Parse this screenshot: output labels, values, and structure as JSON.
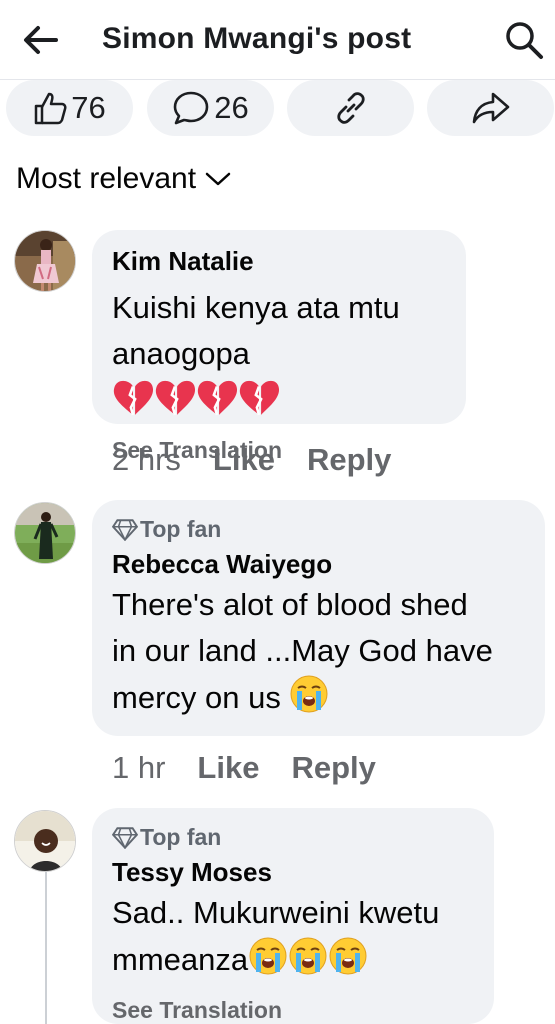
{
  "header": {
    "title": "Simon Mwangi's post",
    "back_icon": "back-arrow-icon",
    "search_icon": "search-icon"
  },
  "actions": {
    "like_count": "76",
    "comment_count": "26",
    "link_icon": "link-icon",
    "share_icon": "share-icon"
  },
  "sort": {
    "label": "Most relevant"
  },
  "comments": [
    {
      "author": "Kim Natalie",
      "badge": "",
      "text": "Kuishi kenya ata mtu anaogopa",
      "emoji": "broken-heart x4",
      "see_translation": "See Translation",
      "time": "2 hrs",
      "like": "Like",
      "reply": "Reply"
    },
    {
      "author": "Rebecca Waiyego",
      "badge": "Top fan",
      "text_line1": "There's alot of blood shed",
      "text_line2": "in our land ...May God have",
      "text_line3": "mercy on us",
      "emoji": "crying-face x1",
      "time": "1 hr",
      "like": "Like",
      "reply": "Reply"
    },
    {
      "author": "Tessy Moses",
      "badge": "Top fan",
      "text_line1": "Sad.. Mukurweini kwetu",
      "text_line2": "mmeanza",
      "emoji": "crying-face x3",
      "see_translation": "See Translation"
    }
  ],
  "colors": {
    "bubble_bg": "#f0f2f5",
    "secondary_text": "#65676b",
    "primary_text": "#050505",
    "broken_heart": "#e8344e",
    "emoji_yellow": "#ffcc33"
  }
}
